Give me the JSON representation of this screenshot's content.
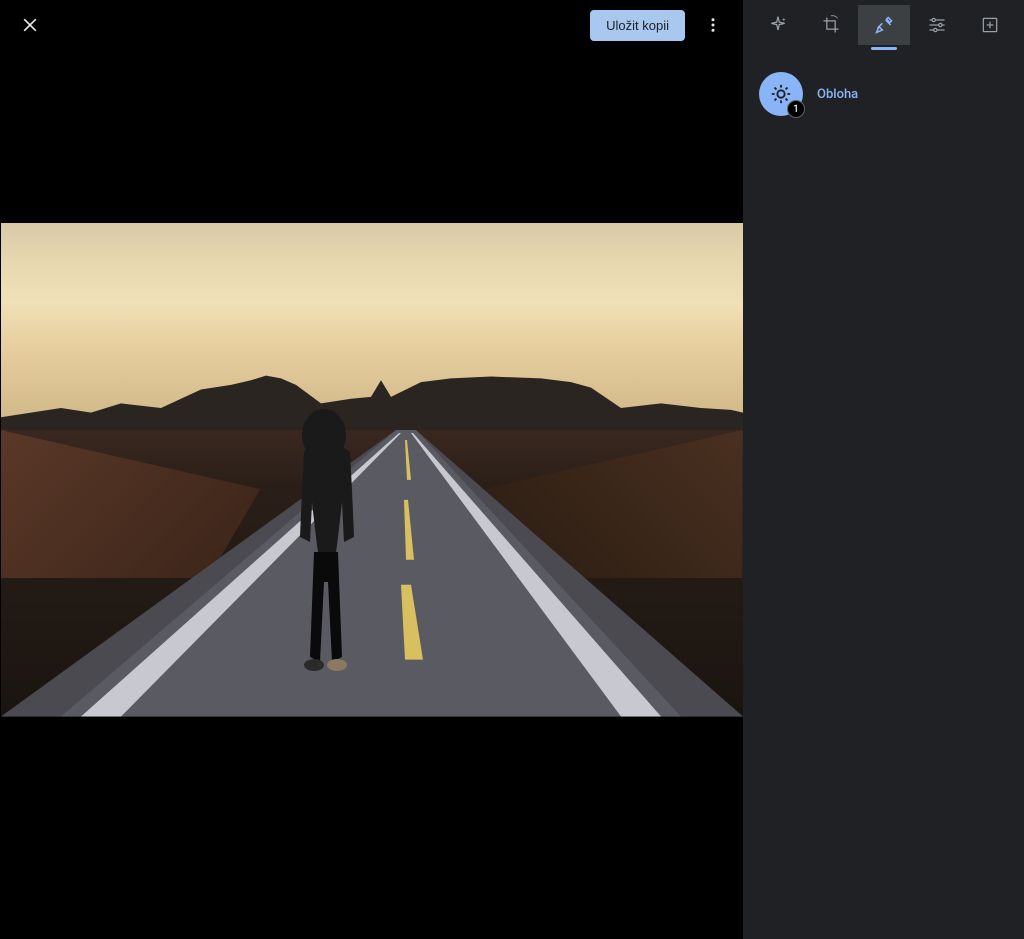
{
  "header": {
    "save_button_label": "Uložit kopii"
  },
  "sidebar": {
    "tabs": [
      {
        "name": "suggestions"
      },
      {
        "name": "crop"
      },
      {
        "name": "tools"
      },
      {
        "name": "adjust"
      },
      {
        "name": "markup"
      }
    ],
    "active_tab_index": 2,
    "effects": [
      {
        "id": "sky",
        "label": "Obloha",
        "badge": "1"
      }
    ]
  }
}
